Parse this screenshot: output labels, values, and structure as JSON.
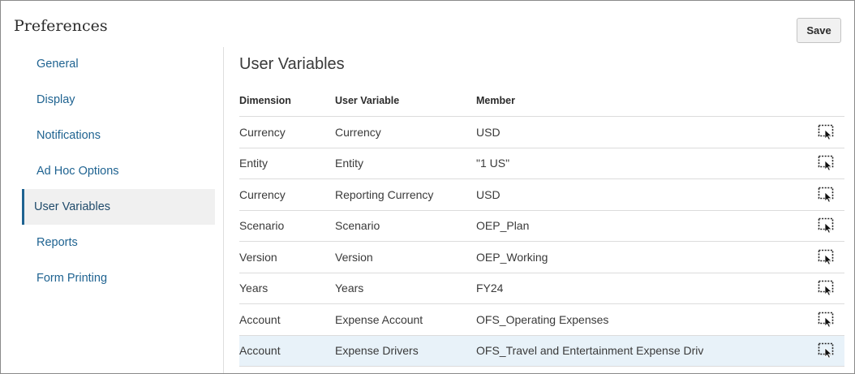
{
  "page": {
    "title": "Preferences"
  },
  "toolbar": {
    "save_label": "Save"
  },
  "sidebar": {
    "items": [
      {
        "label": "General"
      },
      {
        "label": "Display"
      },
      {
        "label": "Notifications"
      },
      {
        "label": "Ad Hoc Options"
      },
      {
        "label": "User Variables",
        "active": true
      },
      {
        "label": "Reports"
      },
      {
        "label": "Form Printing"
      }
    ]
  },
  "main": {
    "section_title": "User Variables",
    "table": {
      "headers": {
        "dimension": "Dimension",
        "user_variable": "User Variable",
        "member": "Member"
      },
      "rows": [
        {
          "dimension": "Currency",
          "user_variable": "Currency",
          "member": "USD",
          "icon": "member-selector-icon"
        },
        {
          "dimension": "Entity",
          "user_variable": "Entity",
          "member": "\"1 US\"",
          "icon": "member-selector-icon"
        },
        {
          "dimension": "Currency",
          "user_variable": "Reporting Currency",
          "member": "USD",
          "icon": "member-selector-icon"
        },
        {
          "dimension": "Scenario",
          "user_variable": "Scenario",
          "member": "OEP_Plan",
          "icon": "member-selector-icon"
        },
        {
          "dimension": "Version",
          "user_variable": "Version",
          "member": " OEP_Working",
          "icon": "member-selector-icon"
        },
        {
          "dimension": "Years",
          "user_variable": "Years",
          "member": "FY24",
          "icon": "member-selector-icon"
        },
        {
          "dimension": "Account",
          "user_variable": "Expense Account",
          "member": "OFS_Operating Expenses",
          "icon": "member-selector-icon"
        },
        {
          "dimension": "Account",
          "user_variable": "Expense Drivers",
          "member": "OFS_Travel and Entertainment Expense Driv",
          "icon": "member-selector-icon",
          "selected": true
        }
      ]
    }
  },
  "colors": {
    "link": "#1f6391",
    "active_bg": "#f0f0f0",
    "selected_row_bg": "#e8f2f9",
    "border": "#dcdcdc"
  }
}
